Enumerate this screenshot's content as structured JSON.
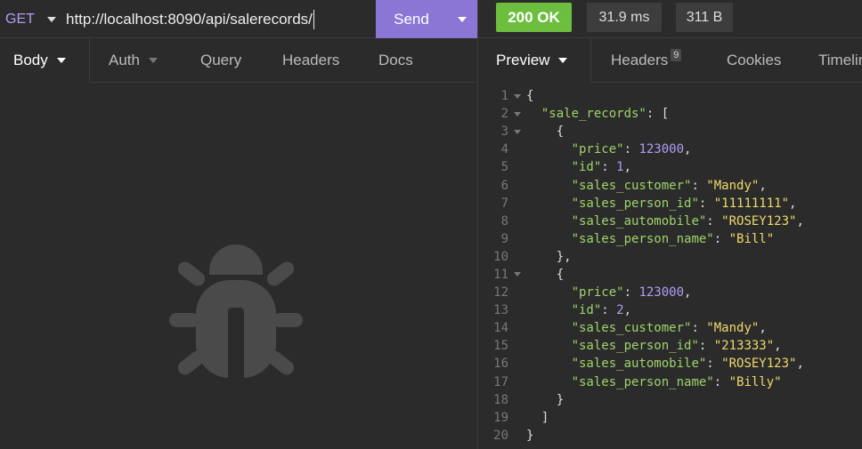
{
  "request": {
    "method": "GET",
    "url": "http://localhost:8090/api/salerecords/",
    "send_label": "Send"
  },
  "response": {
    "status": "200 OK",
    "time": "31.9 ms",
    "size": "311 B"
  },
  "request_tabs": [
    {
      "label": "Body"
    },
    {
      "label": "Auth"
    },
    {
      "label": "Query"
    },
    {
      "label": "Headers"
    },
    {
      "label": "Docs"
    }
  ],
  "response_tabs": [
    {
      "label": "Preview"
    },
    {
      "label": "Headers",
      "badge": "9"
    },
    {
      "label": "Cookies"
    },
    {
      "label": "Timeline"
    }
  ],
  "colors": {
    "accent": "#8b76d6",
    "status_ok": "#6dbe3e",
    "key": "#9ed36a",
    "string": "#f0d96a",
    "number": "#b39cf3"
  },
  "empty_state_icon": "bug-icon",
  "json_lines": [
    {
      "n": "1",
      "fold": true,
      "t": [
        [
          "p",
          "{"
        ]
      ]
    },
    {
      "n": "2",
      "fold": true,
      "t": [
        [
          "p",
          "  "
        ],
        [
          "k",
          "\"sale_records\""
        ],
        [
          "p",
          ": ["
        ]
      ]
    },
    {
      "n": "3",
      "fold": true,
      "t": [
        [
          "p",
          "    {"
        ]
      ]
    },
    {
      "n": "4",
      "fold": false,
      "t": [
        [
          "p",
          "      "
        ],
        [
          "k",
          "\"price\""
        ],
        [
          "p",
          ": "
        ],
        [
          "n",
          "123000"
        ],
        [
          "p",
          ","
        ]
      ]
    },
    {
      "n": "5",
      "fold": false,
      "t": [
        [
          "p",
          "      "
        ],
        [
          "k",
          "\"id\""
        ],
        [
          "p",
          ": "
        ],
        [
          "n",
          "1"
        ],
        [
          "p",
          ","
        ]
      ]
    },
    {
      "n": "6",
      "fold": false,
      "t": [
        [
          "p",
          "      "
        ],
        [
          "k",
          "\"sales_customer\""
        ],
        [
          "p",
          ": "
        ],
        [
          "s",
          "\"Mandy\""
        ],
        [
          "p",
          ","
        ]
      ]
    },
    {
      "n": "7",
      "fold": false,
      "t": [
        [
          "p",
          "      "
        ],
        [
          "k",
          "\"sales_person_id\""
        ],
        [
          "p",
          ": "
        ],
        [
          "s",
          "\"11111111\""
        ],
        [
          "p",
          ","
        ]
      ]
    },
    {
      "n": "8",
      "fold": false,
      "t": [
        [
          "p",
          "      "
        ],
        [
          "k",
          "\"sales_automobile\""
        ],
        [
          "p",
          ": "
        ],
        [
          "s",
          "\"ROSEY123\""
        ],
        [
          "p",
          ","
        ]
      ]
    },
    {
      "n": "9",
      "fold": false,
      "t": [
        [
          "p",
          "      "
        ],
        [
          "k",
          "\"sales_person_name\""
        ],
        [
          "p",
          ": "
        ],
        [
          "s",
          "\"Bill\""
        ]
      ]
    },
    {
      "n": "10",
      "fold": false,
      "t": [
        [
          "p",
          "    },"
        ]
      ]
    },
    {
      "n": "11",
      "fold": true,
      "t": [
        [
          "p",
          "    {"
        ]
      ]
    },
    {
      "n": "12",
      "fold": false,
      "t": [
        [
          "p",
          "      "
        ],
        [
          "k",
          "\"price\""
        ],
        [
          "p",
          ": "
        ],
        [
          "n",
          "123000"
        ],
        [
          "p",
          ","
        ]
      ]
    },
    {
      "n": "13",
      "fold": false,
      "t": [
        [
          "p",
          "      "
        ],
        [
          "k",
          "\"id\""
        ],
        [
          "p",
          ": "
        ],
        [
          "n",
          "2"
        ],
        [
          "p",
          ","
        ]
      ]
    },
    {
      "n": "14",
      "fold": false,
      "t": [
        [
          "p",
          "      "
        ],
        [
          "k",
          "\"sales_customer\""
        ],
        [
          "p",
          ": "
        ],
        [
          "s",
          "\"Mandy\""
        ],
        [
          "p",
          ","
        ]
      ]
    },
    {
      "n": "15",
      "fold": false,
      "t": [
        [
          "p",
          "      "
        ],
        [
          "k",
          "\"sales_person_id\""
        ],
        [
          "p",
          ": "
        ],
        [
          "s",
          "\"213333\""
        ],
        [
          "p",
          ","
        ]
      ]
    },
    {
      "n": "16",
      "fold": false,
      "t": [
        [
          "p",
          "      "
        ],
        [
          "k",
          "\"sales_automobile\""
        ],
        [
          "p",
          ": "
        ],
        [
          "s",
          "\"ROSEY123\""
        ],
        [
          "p",
          ","
        ]
      ]
    },
    {
      "n": "17",
      "fold": false,
      "t": [
        [
          "p",
          "      "
        ],
        [
          "k",
          "\"sales_person_name\""
        ],
        [
          "p",
          ": "
        ],
        [
          "s",
          "\"Billy\""
        ]
      ]
    },
    {
      "n": "18",
      "fold": false,
      "t": [
        [
          "p",
          "    }"
        ]
      ]
    },
    {
      "n": "19",
      "fold": false,
      "t": [
        [
          "p",
          "  ]"
        ]
      ]
    },
    {
      "n": "20",
      "fold": false,
      "t": [
        [
          "p",
          "}"
        ]
      ]
    }
  ]
}
